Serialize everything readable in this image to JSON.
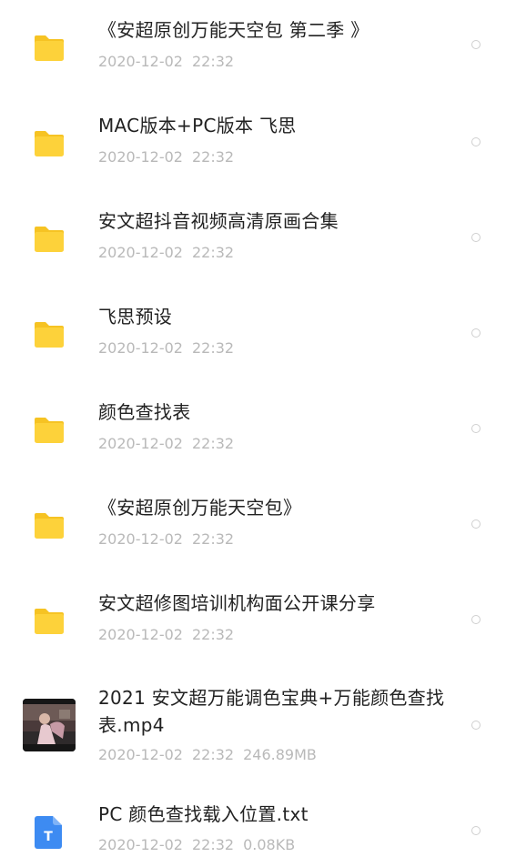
{
  "files": [
    {
      "name": "《安超原创万能天空包 第二季 》",
      "date": "2020-12-02",
      "time": "22:32",
      "size": "",
      "icon": "folder-icon"
    },
    {
      "name": "MAC版本+PC版本 飞思",
      "date": "2020-12-02",
      "time": "22:32",
      "size": "",
      "icon": "folder-icon"
    },
    {
      "name": "安文超抖音视频高清原画合集",
      "date": "2020-12-02",
      "time": "22:32",
      "size": "",
      "icon": "folder-icon"
    },
    {
      "name": "飞思预设",
      "date": "2020-12-02",
      "time": "22:32",
      "size": "",
      "icon": "folder-icon"
    },
    {
      "name": "颜色查找表",
      "date": "2020-12-02",
      "time": "22:32",
      "size": "",
      "icon": "folder-icon"
    },
    {
      "name": "《安超原创万能天空包》",
      "date": "2020-12-02",
      "time": "22:32",
      "size": "",
      "icon": "folder-icon"
    },
    {
      "name": "安文超修图培训机构面公开课分享",
      "date": "2020-12-02",
      "time": "22:32",
      "size": "",
      "icon": "folder-icon"
    },
    {
      "name": "2021 安文超万能调色宝典+万能颜色查找表.mp4",
      "date": "2020-12-02",
      "time": "22:32",
      "size": "246.89MB",
      "icon": "video-thumbnail"
    },
    {
      "name": "PC 颜色查找载入位置.txt",
      "date": "2020-12-02",
      "time": "22:32",
      "size": "0.08KB",
      "icon": "text-file-icon"
    }
  ],
  "colors": {
    "folder": "#FDD23A",
    "folder_tab": "#F6C323",
    "txt_icon": "#3D8BF2",
    "title_text": "#222222",
    "meta_text": "#B9B9B9",
    "radio": "#CFCFCF"
  },
  "txt_icon_letter": "T"
}
